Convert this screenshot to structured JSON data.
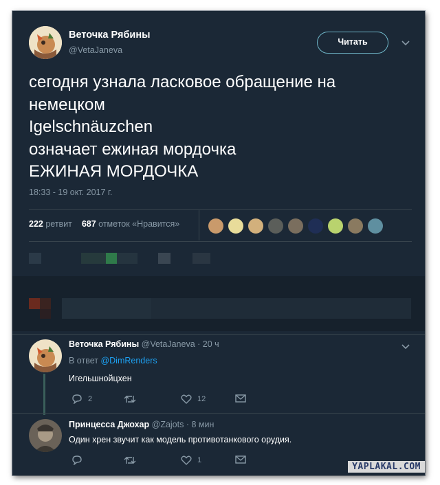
{
  "tweet": {
    "author_name": "Веточка Рябины",
    "author_handle": "@VetaJaneva",
    "follow_label": "Читать",
    "text": "сегодня узнала ласковое обращение на\nнемецком\nIgelschnäuzchen\nозначает ежиная мордочка\nЕЖИНАЯ МОРДОЧКА",
    "timestamp": "18:33 - 19 окт. 2017 г.",
    "retweets_count": "222",
    "retweets_label": "ретвит",
    "likes_count": "687",
    "likes_label": "отметок «Нравится»"
  },
  "replies": [
    {
      "author_name": "Веточка Рябины",
      "meta": "@VetaJaneva · 20 ч",
      "reply_to_prefix": "В ответ",
      "reply_to_handle": "@DimRenders",
      "text": "Игельшнойцхен",
      "reply_count": "2",
      "retweet_count": "",
      "like_count": "12"
    },
    {
      "author_name": "Принцесса Джохар",
      "meta": "@Zajots · 8 мин",
      "text": "Один хрен звучит как модель противотанкового орудия.",
      "reply_count": "",
      "retweet_count": "",
      "like_count": "1"
    }
  ],
  "watermark": "YAPLAKAL.COM",
  "colors": {
    "background": "#1b2836",
    "accent": "#1da1f2",
    "muted_text": "#8899a6",
    "divider": "#38444d"
  }
}
